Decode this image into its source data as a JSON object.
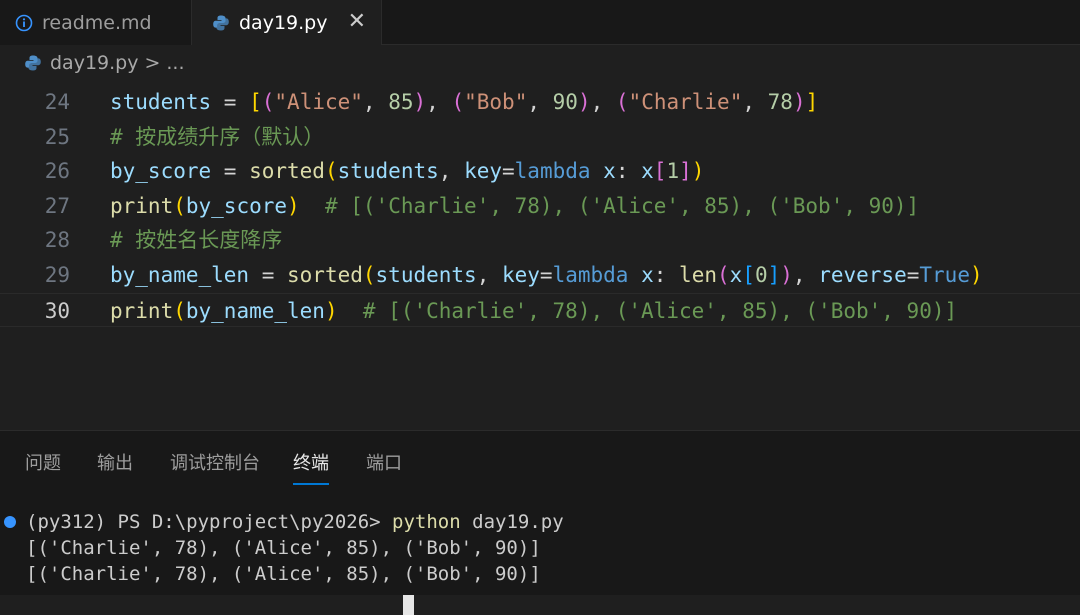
{
  "tabs": [
    {
      "label": "readme.md",
      "icon": "info-icon",
      "active": false
    },
    {
      "label": "day19.py",
      "icon": "python-icon",
      "active": true
    }
  ],
  "breadcrumb": {
    "file": "day19.py",
    "separator": ">",
    "more": "..."
  },
  "editor": {
    "current_line": "30",
    "lines": [
      {
        "num": "24",
        "tokens": [
          {
            "t": "students",
            "c": "v"
          },
          {
            "t": " = ",
            "c": "op"
          },
          {
            "t": "[",
            "c": "b1"
          },
          {
            "t": "(",
            "c": "b2"
          },
          {
            "t": "\"Alice\"",
            "c": "s"
          },
          {
            "t": ", ",
            "c": "op"
          },
          {
            "t": "85",
            "c": "n"
          },
          {
            "t": ")",
            "c": "b2"
          },
          {
            "t": ", ",
            "c": "op"
          },
          {
            "t": "(",
            "c": "b2"
          },
          {
            "t": "\"Bob\"",
            "c": "s"
          },
          {
            "t": ", ",
            "c": "op"
          },
          {
            "t": "90",
            "c": "n"
          },
          {
            "t": ")",
            "c": "b2"
          },
          {
            "t": ", ",
            "c": "op"
          },
          {
            "t": "(",
            "c": "b2"
          },
          {
            "t": "\"Charlie\"",
            "c": "s"
          },
          {
            "t": ", ",
            "c": "op"
          },
          {
            "t": "78",
            "c": "n"
          },
          {
            "t": ")",
            "c": "b2"
          },
          {
            "t": "]",
            "c": "b1"
          }
        ]
      },
      {
        "num": "25",
        "tokens": [
          {
            "t": "# 按成绩升序（默认）",
            "c": "c"
          }
        ]
      },
      {
        "num": "26",
        "tokens": [
          {
            "t": "by_score",
            "c": "v"
          },
          {
            "t": " = ",
            "c": "op"
          },
          {
            "t": "sorted",
            "c": "f"
          },
          {
            "t": "(",
            "c": "b1"
          },
          {
            "t": "students",
            "c": "v"
          },
          {
            "t": ", ",
            "c": "op"
          },
          {
            "t": "key",
            "c": "v"
          },
          {
            "t": "=",
            "c": "op"
          },
          {
            "t": "lambda",
            "c": "k"
          },
          {
            "t": " ",
            "c": "op"
          },
          {
            "t": "x",
            "c": "v"
          },
          {
            "t": ": ",
            "c": "op"
          },
          {
            "t": "x",
            "c": "v"
          },
          {
            "t": "[",
            "c": "b2"
          },
          {
            "t": "1",
            "c": "n"
          },
          {
            "t": "]",
            "c": "b2"
          },
          {
            "t": ")",
            "c": "b1"
          }
        ]
      },
      {
        "num": "27",
        "tokens": [
          {
            "t": "print",
            "c": "f"
          },
          {
            "t": "(",
            "c": "b1"
          },
          {
            "t": "by_score",
            "c": "v"
          },
          {
            "t": ")",
            "c": "b1"
          },
          {
            "t": "  # [('Charlie', 78), ('Alice', 85), ('Bob', 90)]",
            "c": "c"
          }
        ]
      },
      {
        "num": "28",
        "tokens": [
          {
            "t": "# 按姓名长度降序",
            "c": "c"
          }
        ]
      },
      {
        "num": "29",
        "tokens": [
          {
            "t": "by_name_len",
            "c": "v"
          },
          {
            "t": " = ",
            "c": "op"
          },
          {
            "t": "sorted",
            "c": "f"
          },
          {
            "t": "(",
            "c": "b1"
          },
          {
            "t": "students",
            "c": "v"
          },
          {
            "t": ", ",
            "c": "op"
          },
          {
            "t": "key",
            "c": "v"
          },
          {
            "t": "=",
            "c": "op"
          },
          {
            "t": "lambda",
            "c": "k"
          },
          {
            "t": " ",
            "c": "op"
          },
          {
            "t": "x",
            "c": "v"
          },
          {
            "t": ": ",
            "c": "op"
          },
          {
            "t": "len",
            "c": "f"
          },
          {
            "t": "(",
            "c": "b2"
          },
          {
            "t": "x",
            "c": "v"
          },
          {
            "t": "[",
            "c": "b3"
          },
          {
            "t": "0",
            "c": "n"
          },
          {
            "t": "]",
            "c": "b3"
          },
          {
            "t": ")",
            "c": "b2"
          },
          {
            "t": ", ",
            "c": "op"
          },
          {
            "t": "reverse",
            "c": "v"
          },
          {
            "t": "=",
            "c": "op"
          },
          {
            "t": "True",
            "c": "k"
          },
          {
            "t": ")",
            "c": "b1"
          }
        ]
      },
      {
        "num": "30",
        "tokens": [
          {
            "t": "print",
            "c": "f"
          },
          {
            "t": "(",
            "c": "b1"
          },
          {
            "t": "by_name_len",
            "c": "v"
          },
          {
            "t": ")",
            "c": "b1"
          },
          {
            "t": "  # [('Charlie', 78), ('Alice', 85), ('Bob', 90)]",
            "c": "c"
          }
        ]
      }
    ]
  },
  "panel": {
    "tabs": [
      "问题",
      "输出",
      "调试控制台",
      "终端",
      "端口"
    ],
    "active_tab": "终端"
  },
  "terminal": {
    "prompt": "(py312) PS D:\\pyproject\\py2026> ",
    "command": "python",
    "arg": " day19.py",
    "output": [
      "[('Charlie', 78), ('Alice', 85), ('Bob', 90)]",
      "[('Charlie', 78), ('Alice', 85), ('Bob', 90)]"
    ]
  },
  "colors": {
    "accent": "#0078d4",
    "status_dot": "#3794ff",
    "background": "#1f1f1f"
  }
}
